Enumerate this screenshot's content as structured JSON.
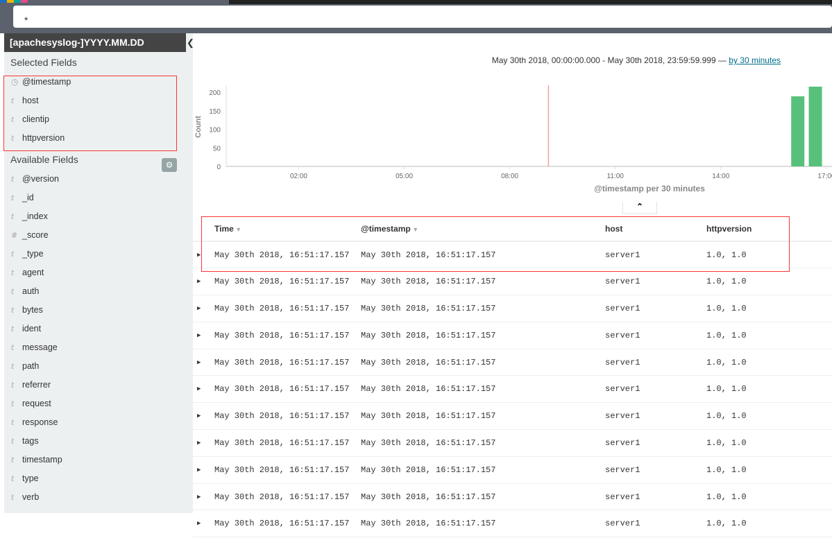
{
  "colors": {
    "bar": "#57c17b",
    "marker": "#f3a1a1",
    "highlight": "#ff3333",
    "sidebar_header": "#444444"
  },
  "query": {
    "value": "*"
  },
  "sidebar": {
    "index_pattern": "[apachesyslog-]YYYY.MM.DD",
    "selected_title": "Selected Fields",
    "available_title": "Available Fields",
    "selected": [
      {
        "type": "clock",
        "name": "@timestamp"
      },
      {
        "type": "t",
        "name": "host"
      },
      {
        "type": "t",
        "name": "clientip"
      },
      {
        "type": "t",
        "name": "httpversion"
      }
    ],
    "available": [
      {
        "type": "t",
        "name": "@version"
      },
      {
        "type": "t",
        "name": "_id"
      },
      {
        "type": "t",
        "name": "_index"
      },
      {
        "type": "#",
        "name": "_score"
      },
      {
        "type": "t",
        "name": "_type"
      },
      {
        "type": "t",
        "name": "agent"
      },
      {
        "type": "t",
        "name": "auth"
      },
      {
        "type": "t",
        "name": "bytes"
      },
      {
        "type": "t",
        "name": "ident"
      },
      {
        "type": "t",
        "name": "message"
      },
      {
        "type": "t",
        "name": "path"
      },
      {
        "type": "t",
        "name": "referrer"
      },
      {
        "type": "t",
        "name": "request"
      },
      {
        "type": "t",
        "name": "response"
      },
      {
        "type": "t",
        "name": "tags"
      },
      {
        "type": "t",
        "name": "timestamp"
      },
      {
        "type": "t",
        "name": "type"
      },
      {
        "type": "t",
        "name": "verb"
      }
    ]
  },
  "time_range": {
    "text": "May 30th 2018, 00:00:00.000 - May 30th 2018, 23:59:59.999 — ",
    "interval_link": "by 30 minutes"
  },
  "chart_data": {
    "type": "bar",
    "xlabel": "@timestamp per 30 minutes",
    "ylabel": "Count",
    "x_ticks": [
      "02:00",
      "05:00",
      "08:00",
      "11:00",
      "14:00",
      "17:00"
    ],
    "y_ticks": [
      0,
      50,
      100,
      150,
      200
    ],
    "ylim": [
      0,
      220
    ],
    "xlim_hours": [
      0,
      17.2
    ],
    "bars": [
      {
        "x": "16:00",
        "value": 189
      },
      {
        "x": "16:30",
        "value": 215
      }
    ],
    "marker_time": "09:06"
  },
  "table": {
    "columns": [
      {
        "label": "Time",
        "sortable": true
      },
      {
        "label": "@timestamp",
        "sortable": true
      },
      {
        "label": "host",
        "sortable": false
      },
      {
        "label": "httpversion",
        "sortable": false
      }
    ],
    "rows": [
      [
        "May 30th 2018, 16:51:17.157",
        "May 30th 2018, 16:51:17.157",
        "server1",
        "1.0, 1.0"
      ],
      [
        "May 30th 2018, 16:51:17.157",
        "May 30th 2018, 16:51:17.157",
        "server1",
        "1.0, 1.0"
      ],
      [
        "May 30th 2018, 16:51:17.157",
        "May 30th 2018, 16:51:17.157",
        "server1",
        "1.0, 1.0"
      ],
      [
        "May 30th 2018, 16:51:17.157",
        "May 30th 2018, 16:51:17.157",
        "server1",
        "1.0, 1.0"
      ],
      [
        "May 30th 2018, 16:51:17.157",
        "May 30th 2018, 16:51:17.157",
        "server1",
        "1.0, 1.0"
      ],
      [
        "May 30th 2018, 16:51:17.157",
        "May 30th 2018, 16:51:17.157",
        "server1",
        "1.0, 1.0"
      ],
      [
        "May 30th 2018, 16:51:17.157",
        "May 30th 2018, 16:51:17.157",
        "server1",
        "1.0, 1.0"
      ],
      [
        "May 30th 2018, 16:51:17.157",
        "May 30th 2018, 16:51:17.157",
        "server1",
        "1.0, 1.0"
      ],
      [
        "May 30th 2018, 16:51:17.157",
        "May 30th 2018, 16:51:17.157",
        "server1",
        "1.0, 1.0"
      ],
      [
        "May 30th 2018, 16:51:17.157",
        "May 30th 2018, 16:51:17.157",
        "server1",
        "1.0, 1.0"
      ],
      [
        "May 30th 2018, 16:51:17.157",
        "May 30th 2018, 16:51:17.157",
        "server1",
        "1.0, 1.0"
      ]
    ]
  }
}
